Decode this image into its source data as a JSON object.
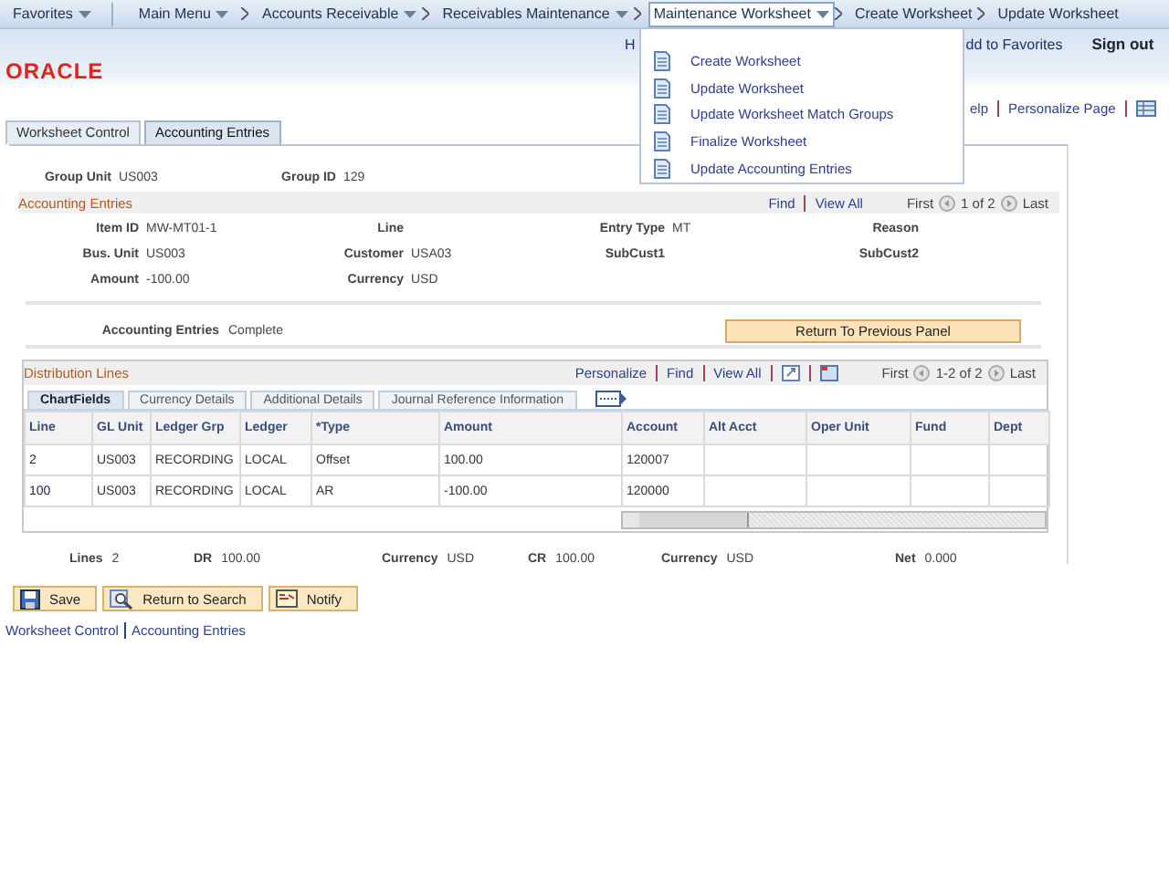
{
  "nav": {
    "items": [
      {
        "label": "Favorites",
        "kind": "menu",
        "dropdown": true,
        "selected": false
      },
      {
        "label": "Main Menu",
        "kind": "menu",
        "dropdown": true,
        "selected": false
      },
      {
        "label": "Accounts Receivable",
        "kind": "crumb",
        "dropdown": true,
        "selected": false
      },
      {
        "label": "Receivables Maintenance",
        "kind": "crumb",
        "dropdown": true,
        "selected": false
      },
      {
        "label": "Maintenance Worksheet",
        "kind": "crumb",
        "dropdown": true,
        "selected": true
      },
      {
        "label": "Create Worksheet",
        "kind": "crumb",
        "dropdown": false,
        "selected": false
      },
      {
        "label": "Update Worksheet",
        "kind": "crumb",
        "dropdown": false,
        "selected": false
      }
    ]
  },
  "dropdown_menu": {
    "items": [
      "Create Worksheet",
      "Update Worksheet",
      "Update Worksheet Match Groups",
      "Finalize Worksheet",
      "Update Accounting Entries"
    ]
  },
  "header": {
    "logo": "ORACLE",
    "links": [
      "H",
      "dd to Favorites"
    ],
    "sign_out": "Sign out"
  },
  "page_links": [
    "elp",
    "Personalize Page"
  ],
  "tabs": [
    {
      "label": "Worksheet Control",
      "selected": false
    },
    {
      "label": "Accounting Entries",
      "selected": true
    }
  ],
  "header_fields": [
    {
      "label": "Group Unit",
      "value": "US003"
    },
    {
      "label": "Group ID",
      "value": "129"
    }
  ],
  "accounting_entries": {
    "title": "Accounting Entries",
    "find": "Find",
    "view_all": "View All",
    "first": "First",
    "count": "1 of 2",
    "last": "Last",
    "rows": [
      [
        {
          "label": "Item ID",
          "value": "MW-MT01-1"
        },
        {
          "label": "Line"
        },
        {
          "label": "Entry Type",
          "value": "MT"
        },
        {
          "label": "Reason"
        }
      ],
      [
        {
          "label": "Bus. Unit",
          "value": "US003"
        },
        {
          "label": "Customer",
          "value": "USA03"
        },
        {
          "label": "SubCust1"
        },
        {
          "label": "SubCust2"
        }
      ],
      [
        {
          "label": "Amount",
          "value": "-100.00"
        },
        {
          "label": "Currency",
          "value": "USD"
        }
      ]
    ],
    "status": {
      "label": "Accounting Entries",
      "value": "Complete"
    },
    "return_button": "Return To Previous Panel"
  },
  "distribution": {
    "title": "Distribution Lines",
    "personalize": "Personalize",
    "find": "Find",
    "view_all": "View All",
    "first": "First",
    "count": "1-2 of 2",
    "last": "Last",
    "tabs": [
      {
        "label": "ChartFields",
        "selected": true
      },
      {
        "label": "Currency Details",
        "selected": false
      },
      {
        "label": "Additional Details",
        "selected": false
      },
      {
        "label": "Journal Reference Information",
        "selected": false
      }
    ],
    "columns": [
      "Line",
      "GL Unit",
      "Ledger Grp",
      "Ledger",
      "*Type",
      "Amount",
      "Account",
      "Alt Acct",
      "Oper Unit",
      "Fund",
      "Dept"
    ],
    "rows": [
      [
        "2",
        "US003",
        "RECORDING",
        "LOCAL",
        "Offset",
        "100.00",
        "120007"
      ],
      [
        "100",
        "US003",
        "RECORDING",
        "LOCAL",
        "AR",
        "-100.00",
        "120000"
      ]
    ]
  },
  "totals": [
    {
      "label": "Lines",
      "value": "2"
    },
    {
      "label": "DR",
      "value": "100.00"
    },
    {
      "label": "Currency",
      "value": "USD"
    },
    {
      "label": "CR",
      "value": "100.00"
    },
    {
      "label": "Currency",
      "value": "USD"
    },
    {
      "label": "Net",
      "value": "0.000"
    }
  ],
  "buttons": [
    {
      "label": "Save",
      "kind": "save"
    },
    {
      "label": "Return to Search",
      "kind": "search"
    },
    {
      "label": "Notify",
      "kind": "notify"
    }
  ],
  "footer_links": [
    "Worksheet Control",
    "Accounting Entries"
  ]
}
